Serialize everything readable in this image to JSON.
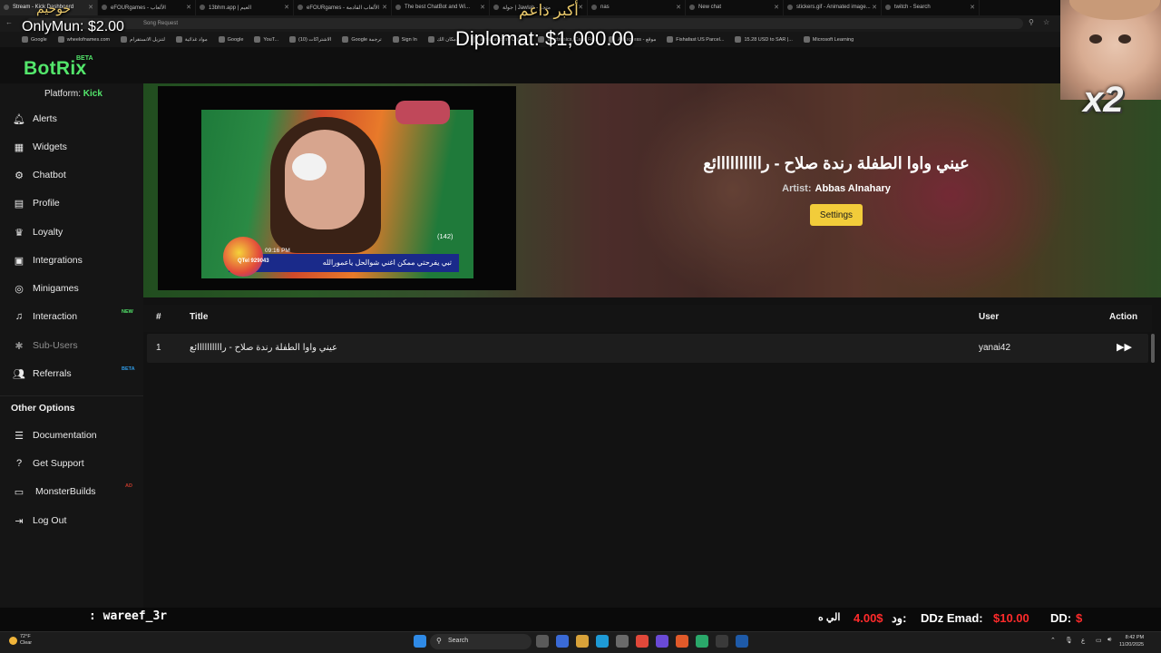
{
  "browser": {
    "tabs": [
      {
        "label": "Stream - Kick Dashboard",
        "active": true
      },
      {
        "label": "eFOURgames - الألعاب"
      },
      {
        "label": "13bhm.app | العيم"
      },
      {
        "label": "eFOURgames - الألعاب القادمة"
      },
      {
        "label": "The best ChatBot and Wi..."
      },
      {
        "label": "جولة | Jawlah - متجر"
      },
      {
        "label": "nas"
      },
      {
        "label": "New chat"
      },
      {
        "label": "stickers.gif - Animated image..."
      },
      {
        "label": "twitch - Search"
      }
    ],
    "url": "Song Request",
    "bookmarks": [
      "Google",
      "wheelofnames.com",
      "لتنزيل الانستقرام",
      "مواد غذائية",
      "Google",
      "YouT...",
      "(10) الاشتراكات",
      "Google ترجمة",
      "Sign In",
      "مكان الك...",
      "amazon.com: Onlin...",
      "Electronics, Cars, Fa...",
      "AliExpress - موقع",
      "Fishafast US Parcel...",
      "15.28 USD to SAR |...",
      "Microsoft Learning"
    ]
  },
  "overlays": {
    "onlymun": "OnlyMun: $2.00",
    "diplomat": "Diplomat: $1,000.00",
    "arabic_top": "أكبر داعم",
    "arabic_left": "خوحيم",
    "multiplier": "x2"
  },
  "app": {
    "logo": "BotRix",
    "logo_badge": "BETA",
    "platform_label": "Platform:",
    "platform_value": "Kick"
  },
  "sidebar": {
    "items": [
      {
        "label": "Alerts",
        "icon": "bell-icon"
      },
      {
        "label": "Widgets",
        "icon": "grid-icon"
      },
      {
        "label": "Chatbot",
        "icon": "robot-icon"
      },
      {
        "label": "Profile",
        "icon": "id-card-icon"
      },
      {
        "label": "Loyalty",
        "icon": "trophy-icon"
      },
      {
        "label": "Integrations",
        "icon": "puzzle-icon"
      },
      {
        "label": "Minigames",
        "icon": "gamepad-icon"
      },
      {
        "label": "Interaction",
        "icon": "music-icon",
        "badge": "NEW"
      },
      {
        "label": "Sub-Users",
        "icon": "bee-icon"
      },
      {
        "label": "Referrals",
        "icon": "users-icon",
        "badge": "BETA"
      }
    ],
    "other_options_title": "Other Options",
    "other_items": [
      {
        "label": "Documentation",
        "icon": "book-icon"
      },
      {
        "label": "Get Support",
        "icon": "question-icon"
      },
      {
        "label": "MonsterBuilds",
        "icon": "laptop-icon",
        "badge": "AD"
      },
      {
        "label": "Log Out",
        "icon": "logout-icon"
      }
    ]
  },
  "player": {
    "song_title": "عيني واوا الطفلة رندة صلاح - راااااااااائع",
    "artist_label": "Artist:",
    "artist_name": "Abbas Alnahary",
    "settings_label": "Settings",
    "video_time": "09:16 PM",
    "video_count": "(142)",
    "video_ticker": "تبي يفرحتي ممكن اغني شوالحل ياعمورالله",
    "video_brand": "QTel 929043"
  },
  "queue": {
    "columns": [
      "#",
      "Title",
      "User",
      "Action"
    ],
    "rows": [
      {
        "index": "1",
        "title": "عيني واوا الطفلة رندة صلاح - راااااااااائع",
        "user": "yanai42"
      }
    ]
  },
  "ticker": {
    "left_user": ": wareef_3r",
    "items": [
      {
        "text": "الي ه",
        "amount": ""
      },
      {
        "text": "ود:",
        "amount": "4.00$"
      },
      {
        "text": "DDz Emad:",
        "amount": "$10.00"
      },
      {
        "text": "DD:",
        "amount": "$"
      }
    ]
  },
  "taskbar": {
    "weather_temp": "72°F",
    "weather_desc": "Clear",
    "search_label": "Search",
    "time": "8:42 PM",
    "date": "11/20/2025"
  },
  "colors": {
    "brand_green": "#53e66b",
    "settings_yellow": "#f2cc3a",
    "donation_red": "#ff2b2b"
  }
}
